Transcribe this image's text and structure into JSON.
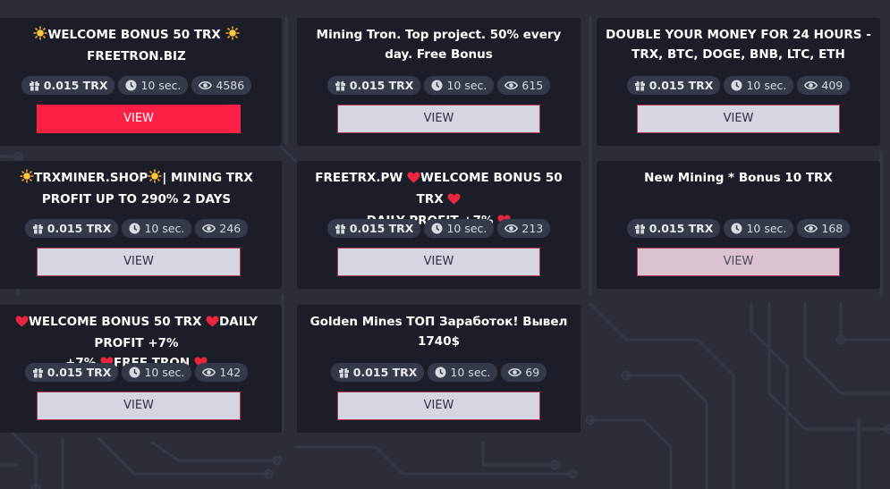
{
  "colors": {
    "background": "#2b2e38",
    "card": "#1b1e28",
    "pill": "#353a4a",
    "button_default": "#d6d6e2",
    "button_active": "#ff2045",
    "button_hover": "#dcc3d1"
  },
  "cards": [
    {
      "title_parts": [
        "",
        "WELCOME BONUS 50 TRX ",
        " FREETRON.BIZ"
      ],
      "reward": "0.015 TRX",
      "timer": "10 sec.",
      "views": "4586",
      "button": "VIEW"
    },
    {
      "title": "Mining Tron. Top project. 50% every day. Free Bonus",
      "reward": "0.015 TRX",
      "timer": "10 sec.",
      "views": "615",
      "button": "VIEW"
    },
    {
      "title": "DOUBLE YOUR MONEY FOR 24 HOURS - TRX, BTC, DOGE, BNB, LTC, ETH",
      "reward": "0.015 TRX",
      "timer": "10 sec.",
      "views": "409",
      "button": "VIEW"
    },
    {
      "title_parts": [
        "",
        "TRXMINER.SHOP",
        "| MINING TRX PROFIT UP TO 290% 2 DAYS"
      ],
      "reward": "0.015 TRX",
      "timer": "10 sec.",
      "views": "246",
      "button": "VIEW"
    },
    {
      "title_parts": [
        "FREETRX.PW ",
        "WELCOME BONUS 50 TRX ",
        "DAILY PROFIT +7% "
      ],
      "reward": "0.015 TRX",
      "timer": "10 sec.",
      "views": "213",
      "button": "VIEW"
    },
    {
      "title": "New Mining * Bonus 10 TRX",
      "reward": "0.015 TRX",
      "timer": "10 sec.",
      "views": "168",
      "button": "VIEW"
    },
    {
      "title_parts": [
        "",
        "WELCOME BONUS 50 TRX ",
        "DAILY PROFIT +7% ",
        "FREE TRON "
      ],
      "reward": "0.015 TRX",
      "timer": "10 sec.",
      "views": "142",
      "button": "VIEW"
    },
    {
      "title": "Golden Mines ТОП Заработок! Вывел 1740$",
      "reward": "0.015 TRX",
      "timer": "10 sec.",
      "views": "69",
      "button": "VIEW"
    }
  ]
}
